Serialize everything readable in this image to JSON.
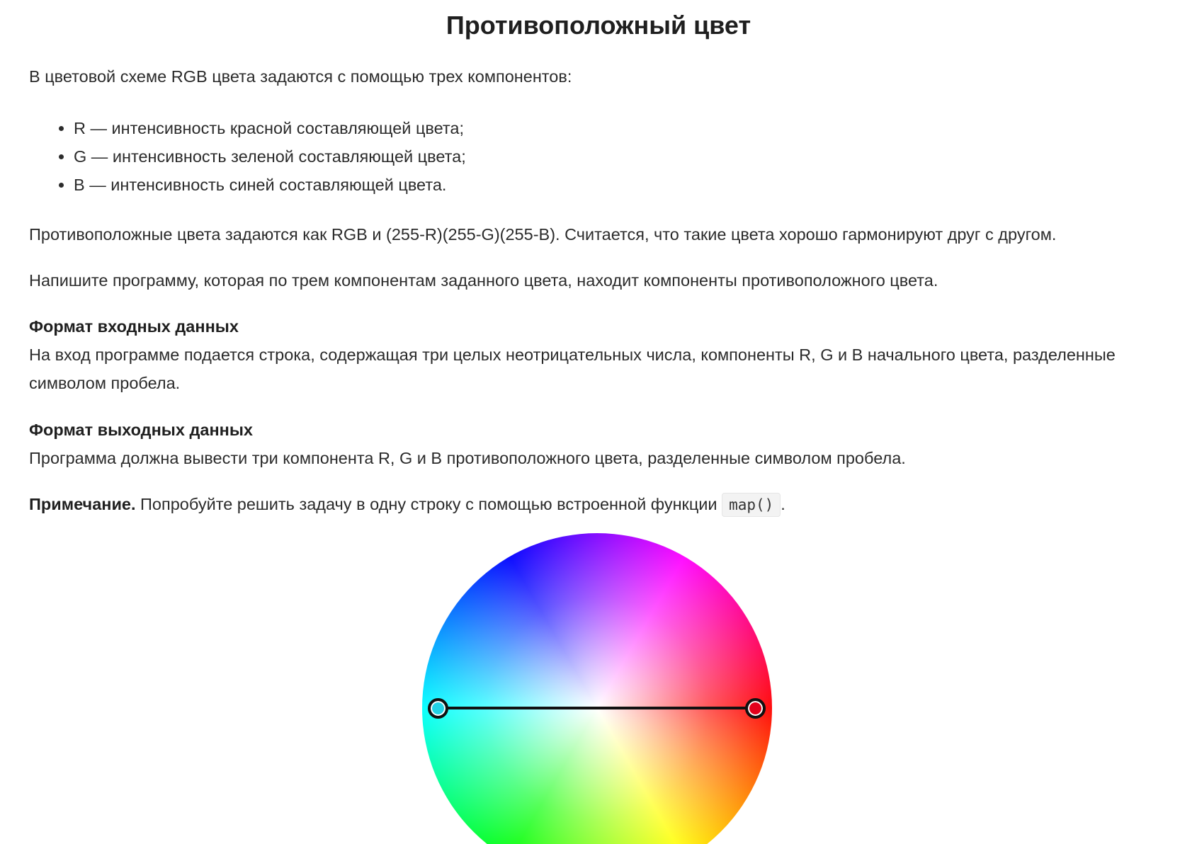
{
  "title": "Противоположный цвет",
  "intro": "В цветовой схеме RGB цвета задаются с помощью трех компонентов:",
  "bullets": [
    "R — интенсивность красной составляющей цвета;",
    "G — интенсивность зеленой составляющей цвета;",
    "B — интенсивность синей составляющей цвета."
  ],
  "opposite_text": "Противоположные цвета задаются как RGB и (255-R)(255-G)(255-B). Считается, что такие цвета хорошо гармонируют друг с другом.",
  "task_text": "Напишите программу, которая по трем компонентам заданного цвета, находит компоненты противоположного цвета.",
  "input_format": {
    "heading": "Формат входных данных",
    "text": "На вход программе подается строка, содержащая три целых неотрицательных числа, компоненты R, G и B начального цвета, разделенные символом пробела."
  },
  "output_format": {
    "heading": "Формат выходных данных",
    "text": "Программа должна вывести три компонента R, G и B противоположного цвета, разделенные символом пробела."
  },
  "note": {
    "label": "Примечание.",
    "text": " Попробуйте решить задачу в одну строку с помощью встроенной функции ",
    "code": "map()",
    "end": "."
  },
  "wheel": {
    "left_handle_color": "#22d3e6",
    "right_handle_color": "#e3001b"
  }
}
